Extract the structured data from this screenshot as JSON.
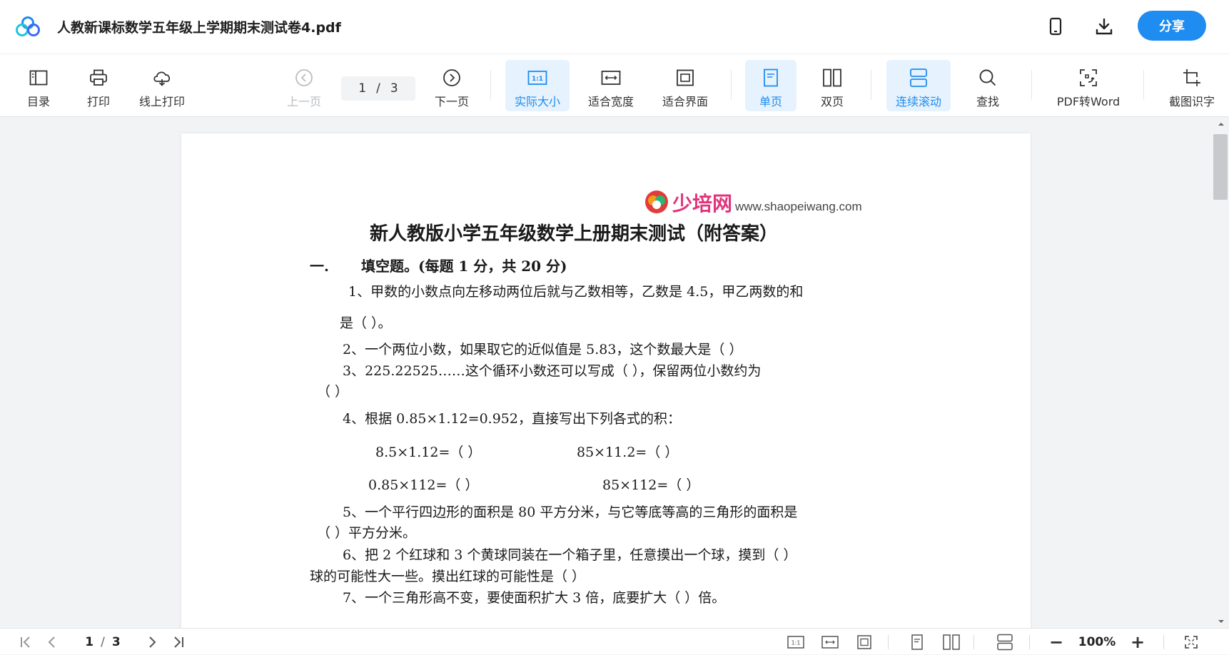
{
  "window": {
    "title": "人教新课标数学五年级上学期期末测试卷4.pdf",
    "share_label": "分享",
    "icons": [
      "phone-icon",
      "download-icon"
    ]
  },
  "toolbar": {
    "catalog": "目录",
    "print": "打印",
    "online_print": "线上打印",
    "prev_page": "上一页",
    "current_page": "1",
    "page_separator": "/",
    "total_pages": "3",
    "next_page": "下一页",
    "actual_size": "实际大小",
    "fit_width": "适合宽度",
    "fit_screen": "适合界面",
    "single_page": "单页",
    "double_page": "双页",
    "continuous_scroll": "连续滚动",
    "find": "查找",
    "pdf_to_word": "PDF转Word",
    "screenshot_ocr": "截图识字",
    "active_color": "#1e8cf0"
  },
  "document": {
    "brand_name": "少培网",
    "brand_url": "www.shaopeiwang.com",
    "heading": "新人教版小学五年级数学上册期末测试（附答案）",
    "section1_num": "一.",
    "section1_title": "填空题。(每题 1 分，共 20 分)",
    "q1a": "1、甲数的小数点向左移动两位后就与乙数相等，乙数是 4.5，甲乙两数的和",
    "q1b": "是（          ）。",
    "q2": "2、一个两位小数，如果取它的近似值是 5.83，这个数最大是（          ）",
    "q3a": "3、225.22525……这个循环小数还可以写成（          ），保留两位小数约为",
    "q3b": "（          ）",
    "q4": "4、根据 0.85×1.12=0.952，直接写出下列各式的积：",
    "q4_1": "8.5×1.12=（            ）",
    "q4_2": "85×11.2=（            ）",
    "q4_3": "0.85×112=（            ）",
    "q4_4": "85×112=（            ）",
    "q5a": "5、一个平行四边形的面积是 80 平方分米，与它等底等高的三角形的面积是",
    "q5b": "（      ）平方分米。",
    "q6a": "6、把 2 个红球和 3 个黄球同装在一个箱子里，任意摸出一个球，摸到（      ）",
    "q6b": "球的可能性大一些。摸出红球的可能性是（        ）",
    "q7": "7、一个三角形高不变，要使面积扩大 3 倍，底要扩大（      ）倍。"
  },
  "bottombar": {
    "current_page": "1",
    "page_separator": "/",
    "total_pages": "3",
    "zoom": "100%",
    "zoom_out": "−",
    "zoom_in": "+"
  }
}
